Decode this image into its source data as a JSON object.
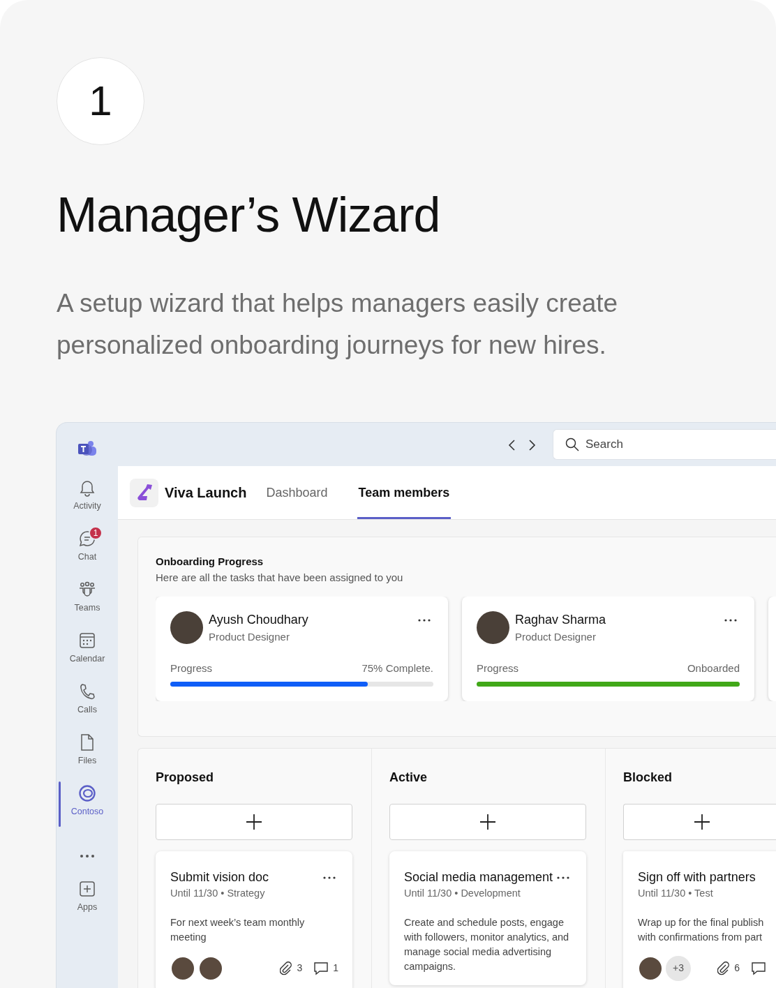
{
  "step_number": "1",
  "title": "Manager’s Wizard",
  "description": "A setup wizard that helps managers easily create personalized onboarding journeys for new hires.",
  "app": {
    "search": {
      "placeholder": "Search"
    },
    "rail": [
      {
        "label": "Activity",
        "selected": false
      },
      {
        "label": "Chat",
        "selected": false,
        "badge": "1"
      },
      {
        "label": "Teams",
        "selected": false
      },
      {
        "label": "Calendar",
        "selected": false
      },
      {
        "label": "Calls",
        "selected": false
      },
      {
        "label": "Files",
        "selected": false
      },
      {
        "label": "Contoso",
        "selected": true
      },
      {
        "kind": "more"
      },
      {
        "label": "Apps",
        "selected": false
      }
    ],
    "app_name": "Viva Launch",
    "tabs": [
      {
        "label": "Dashboard",
        "selected": false
      },
      {
        "label": "Team members",
        "selected": true
      }
    ],
    "progress_section": {
      "title": "Onboarding Progress",
      "subtitle": "Here are all the tasks that have been assigned to you",
      "members": [
        {
          "name": "Ayush Choudhary",
          "role": "Product Designer",
          "progress_label": "Progress",
          "status": "75% Complete.",
          "level": 0.75,
          "color": "#0f5ef7"
        },
        {
          "name": "Raghav Sharma",
          "role": "Product Designer",
          "progress_label": "Progress",
          "status": "Onboarded",
          "level": 1,
          "color": "#41a818"
        }
      ]
    },
    "columns": [
      {
        "title": "Proposed",
        "tasks": [
          {
            "title": "Submit vision doc",
            "meta": "Until 11/30 • Strategy",
            "description": "For next week’s team monthly meeting",
            "assignees": [
              {
                "kind": "photo"
              },
              {
                "kind": "photo"
              }
            ],
            "stats": [
              {
                "kind": "attachments",
                "count": "3"
              },
              {
                "kind": "comments",
                "count": "1"
              }
            ]
          }
        ]
      },
      {
        "title": "Active",
        "tasks": [
          {
            "title": "Social media management",
            "meta": "Until 11/30 • Development",
            "description": "Create and schedule posts, engage with followers, monitor analytics, and manage social media advertising campaigns."
          }
        ]
      },
      {
        "title": "Blocked",
        "tasks": [
          {
            "title": "Sign off with partners",
            "meta": "Until 11/30 • Test",
            "description": "Wrap up for the final publish with confirmations from part",
            "assignees": [
              {
                "kind": "photo"
              },
              {
                "kind": "more",
                "label": "+3"
              }
            ],
            "stats": [
              {
                "kind": "attachments",
                "count": "6"
              },
              {
                "kind": "comments"
              }
            ]
          }
        ]
      }
    ]
  }
}
